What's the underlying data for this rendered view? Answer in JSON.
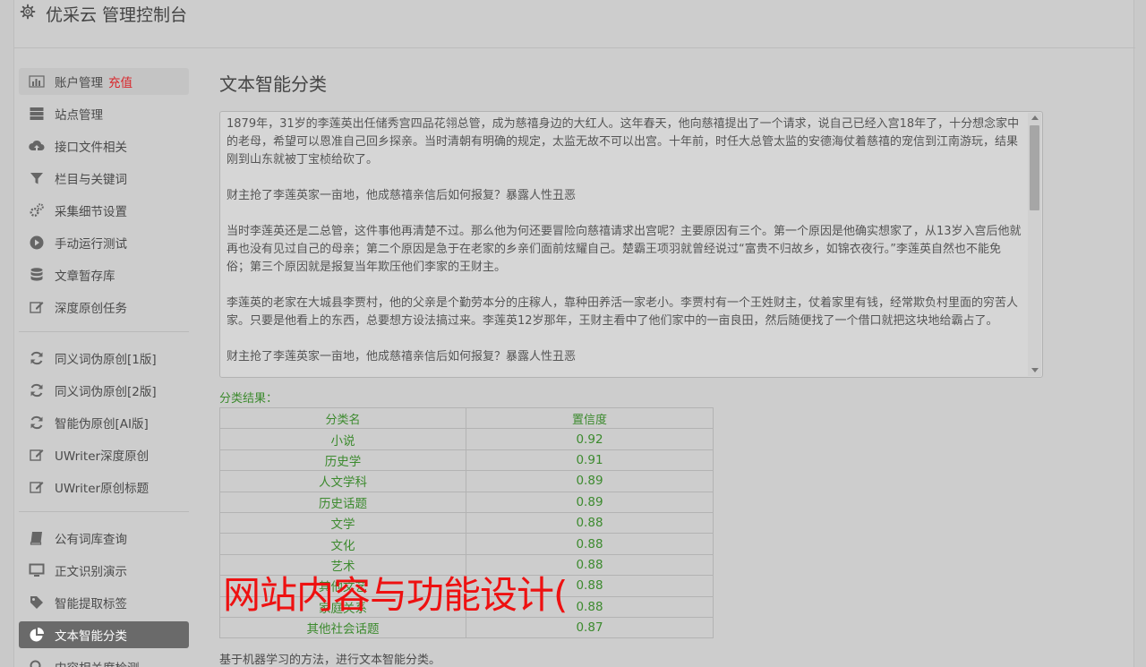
{
  "app": {
    "title": "优采云 管理控制台"
  },
  "sidebar": {
    "group1": [
      {
        "label": "账户管理",
        "extra": "充值",
        "icon": "bar-chart-icon"
      },
      {
        "label": "站点管理",
        "icon": "server-icon"
      },
      {
        "label": "接口文件相关",
        "icon": "cloud-upload-icon"
      },
      {
        "label": "栏目与关键词",
        "icon": "filter-icon"
      },
      {
        "label": "采集细节设置",
        "icon": "gears-icon"
      },
      {
        "label": "手动运行测试",
        "icon": "play-circle-icon"
      },
      {
        "label": "文章暂存库",
        "icon": "database-icon"
      },
      {
        "label": "深度原创任务",
        "icon": "edit-icon"
      }
    ],
    "group2": [
      {
        "label": "同义词伪原创[1版]",
        "icon": "refresh-icon"
      },
      {
        "label": "同义词伪原创[2版]",
        "icon": "refresh-icon"
      },
      {
        "label": "智能伪原创[AI版]",
        "icon": "refresh-icon"
      },
      {
        "label": "UWriter深度原创",
        "icon": "edit-icon"
      },
      {
        "label": "UWriter原创标题",
        "icon": "edit-icon"
      }
    ],
    "group3": [
      {
        "label": "公有词库查询",
        "icon": "book-icon"
      },
      {
        "label": "正文识别演示",
        "icon": "monitor-icon"
      },
      {
        "label": "智能提取标签",
        "icon": "tag-icon"
      },
      {
        "label": "文本智能分类",
        "icon": "pie-chart-icon"
      },
      {
        "label": "内容相关度检测",
        "icon": "search-icon"
      }
    ]
  },
  "main": {
    "title": "文本智能分类",
    "article": [
      "1879年，31岁的李莲英出任储秀宫四品花翎总管，成为慈禧身边的大红人。这年春天，他向慈禧提出了一个请求，说自己已经入宫18年了，十分想念家中的老母，希望可以恩准自己回乡探亲。当时清朝有明确的规定，太监无故不可以出宫。十年前，时任大总管太监的安德海仗着慈禧的宠信到江南游玩，结果刚到山东就被丁宝桢给砍了。",
      "财主抢了李莲英家一亩地，他成慈禧亲信后如何报复？暴露人性丑恶",
      "当时李莲英还是二总管，这件事他再清楚不过。那么他为何还要冒险向慈禧请求出宫呢？主要原因有三个。第一个原因是他确实想家了，从13岁入宫后他就再也没有见过自己的母亲；第二个原因是急于在老家的乡亲们面前炫耀自己。楚霸王项羽就曾经说过“富贵不归故乡，如锦衣夜行。”李莲英自然也不能免俗；第三个原因就是报复当年欺压他们李家的王财主。",
      "李莲英的老家在大城县李贾村，他的父亲是个勤劳本分的庄稼人，靠种田养活一家老小。李贾村有一个王姓财主，仗着家里有钱，经常欺负村里面的穷苦人家。只要是他看上的东西，总要想方设法搞过来。李莲英12岁那年，王财主看中了他们家中的一亩良田，然后随便找了一个借口就把这块地给霸占了。",
      "财主抢了李莲英家一亩地，他成慈禧亲信后如何报复？暴露人性丑恶"
    ],
    "result_label": "分类结果：",
    "table_headers": [
      "分类名",
      "置信度"
    ],
    "results": [
      {
        "name": "小说",
        "score": "0.92"
      },
      {
        "name": "历史学",
        "score": "0.91"
      },
      {
        "name": "人文学科",
        "score": "0.89"
      },
      {
        "name": "历史话题",
        "score": "0.89"
      },
      {
        "name": "文学",
        "score": "0.88"
      },
      {
        "name": "文化",
        "score": "0.88"
      },
      {
        "name": "艺术",
        "score": "0.88"
      },
      {
        "name": "其他文艺",
        "score": "0.88"
      },
      {
        "name": "家庭关系",
        "score": "0.88"
      },
      {
        "name": "其他社会话题",
        "score": "0.87"
      }
    ],
    "footnote": "基于机器学习的方法，进行文本智能分类。"
  },
  "overlay_text": "网站内容与功能设计(",
  "colors": {
    "accent_green": "#3c8a2e",
    "alert_red": "#d9262b",
    "active_bg": "#6a6a6a",
    "overlay_red": "#ee1111"
  }
}
